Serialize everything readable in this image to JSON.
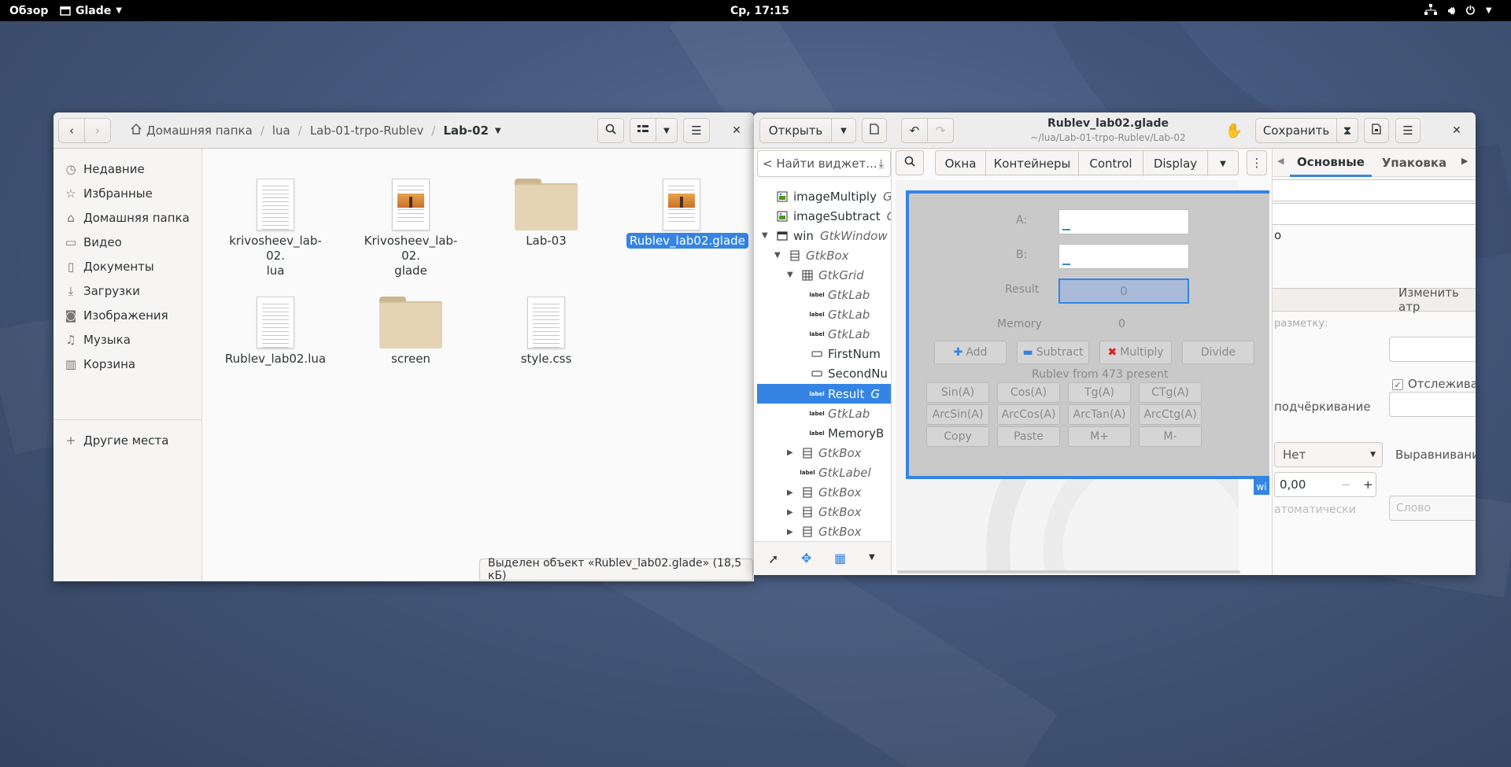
{
  "topbar": {
    "activities": "Обзор",
    "app_name": "Glade",
    "clock": "Ср, 17:15"
  },
  "files": {
    "breadcrumb": [
      "Домашняя папка",
      "lua",
      "Lab-01-trpo-Rublev",
      "Lab-02"
    ],
    "sidebar": [
      {
        "label": "Недавние",
        "icon": "clock-icon"
      },
      {
        "label": "Избранные",
        "icon": "star-icon"
      },
      {
        "label": "Домашняя папка",
        "icon": "home-icon"
      },
      {
        "label": "Видео",
        "icon": "video-icon"
      },
      {
        "label": "Документы",
        "icon": "document-icon"
      },
      {
        "label": "Загрузки",
        "icon": "download-icon"
      },
      {
        "label": "Изображения",
        "icon": "camera-icon"
      },
      {
        "label": "Музыка",
        "icon": "music-icon"
      },
      {
        "label": "Корзина",
        "icon": "trash-icon"
      },
      {
        "label": "Другие места",
        "icon": "plus-icon"
      }
    ],
    "items": [
      {
        "name": "krivosheev_lab-02.\nlua",
        "kind": "text"
      },
      {
        "name": "Krivosheev_lab-02.\nglade",
        "kind": "image-doc"
      },
      {
        "name": "Lab-03",
        "kind": "folder"
      },
      {
        "name": "Rublev_lab02.glade",
        "kind": "image-doc",
        "selected": true
      },
      {
        "name": "Rublev_lab02.lua",
        "kind": "text"
      },
      {
        "name": "screen",
        "kind": "folder"
      },
      {
        "name": "style.css",
        "kind": "text"
      }
    ],
    "status": "Выделен объект «Rublev_lab02.glade» (18,5 кБ)"
  },
  "glade": {
    "open_label": "Открыть",
    "title": "Rublev_lab02.glade",
    "path": "~/lua/Lab-01-trpo-Rublev/Lab-02",
    "save_label": "Сохранить",
    "search_placeholder": "< Найти виджет...",
    "palette_tabs": [
      "Окна",
      "Контейнеры",
      "Control",
      "Display"
    ],
    "inspector_tabs": [
      "Основные",
      "Упаковка"
    ],
    "tree": [
      {
        "name": "imageMultiply",
        "type": "G",
        "icon": "image",
        "depth": 1
      },
      {
        "name": "imageSubtract",
        "type": "G",
        "icon": "image",
        "depth": 1
      },
      {
        "name": "win",
        "type": "GtkWindow",
        "icon": "window",
        "depth": 0,
        "expanded": true
      },
      {
        "name": "",
        "type": "GtkBox",
        "icon": "box",
        "depth": 1,
        "expanded": true
      },
      {
        "name": "",
        "type": "GtkGrid",
        "icon": "grid",
        "depth": 2,
        "expanded": true
      },
      {
        "name": "",
        "type": "GtkLab",
        "icon": "label",
        "depth": 3
      },
      {
        "name": "",
        "type": "GtkLab",
        "icon": "label",
        "depth": 3
      },
      {
        "name": "",
        "type": "GtkLab",
        "icon": "label",
        "depth": 3
      },
      {
        "name": "FirstNum",
        "type": "",
        "icon": "entry",
        "depth": 3
      },
      {
        "name": "SecondNu",
        "type": "",
        "icon": "entry",
        "depth": 3
      },
      {
        "name": "Result",
        "type": "G",
        "icon": "label",
        "depth": 3,
        "selected": true
      },
      {
        "name": "",
        "type": "GtkLab",
        "icon": "label",
        "depth": 3
      },
      {
        "name": "MemoryB",
        "type": "",
        "icon": "label",
        "depth": 3
      },
      {
        "name": "",
        "type": "GtkBox",
        "icon": "box",
        "depth": 2,
        "collapsed": true
      },
      {
        "name": "",
        "type": "GtkLabel",
        "icon": "label",
        "depth": 2
      },
      {
        "name": "",
        "type": "GtkBox",
        "icon": "box",
        "depth": 2,
        "collapsed": true
      },
      {
        "name": "",
        "type": "GtkBox",
        "icon": "box",
        "depth": 2,
        "collapsed": true
      },
      {
        "name": "",
        "type": "GtkBox",
        "icon": "box",
        "depth": 2,
        "collapsed": true
      }
    ],
    "calc": {
      "label_a": "A:",
      "label_b": "B:",
      "label_result": "Result",
      "result_value": "0",
      "label_memory": "Memory",
      "memory_value": "0",
      "ops": [
        "Add",
        "Subtract",
        "Multiply",
        "Divide"
      ],
      "present": "Rublev from 473 present",
      "funcs": [
        "Sin(A)",
        "Cos(A)",
        "Tg(A)",
        "CTg(A)",
        "ArcSin(A)",
        "ArcCos(A)",
        "ArcTan(A)",
        "ArcCtg(A)",
        "Copy",
        "Paste",
        "M+",
        "M-"
      ],
      "corner_tag": "wi"
    },
    "props": {
      "value_o": "o",
      "change_attrs": "Изменить атр",
      "markup": "разметку:",
      "track": "Отслеживат",
      "underline": "подчёркивание",
      "none_option": "Нет",
      "alignment": "Выравнивание",
      "angle_value": "0,00",
      "auto": "атоматически",
      "word_placeholder": "Слово"
    }
  }
}
